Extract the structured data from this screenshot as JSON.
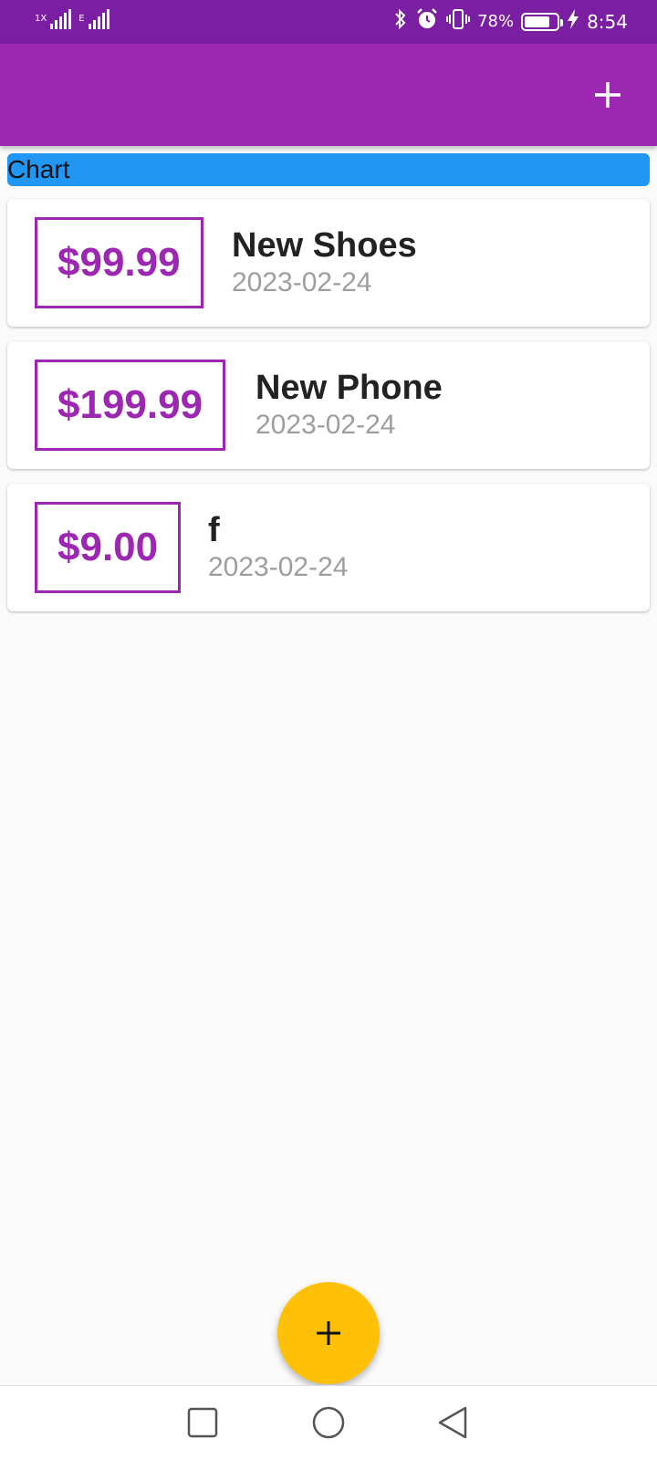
{
  "status_bar": {
    "sim1_tag": "1X",
    "sim2_tag": "E",
    "battery_percent_text": "78%",
    "battery_level": 0.78,
    "time": "8:54",
    "icons": [
      "signal-icon",
      "bluetooth-icon",
      "alarm-icon",
      "vibrate-icon",
      "battery-icon",
      "charging-icon"
    ]
  },
  "app_bar": {
    "title": "",
    "add_icon": "plus-icon"
  },
  "chart": {
    "label": "Chart"
  },
  "transactions": [
    {
      "amount": "$99.99",
      "title": "New Shoes",
      "date": "2023-02-24"
    },
    {
      "amount": "$199.99",
      "title": "New Phone",
      "date": "2023-02-24"
    },
    {
      "amount": "$9.00",
      "title": "f",
      "date": "2023-02-24"
    }
  ],
  "fab": {
    "icon": "plus-icon"
  },
  "nav_bar": {
    "icons": [
      "recents-square-icon",
      "home-circle-icon",
      "back-triangle-icon"
    ]
  },
  "colors": {
    "status_bar": "#7B1FA2",
    "primary": "#9C27B0",
    "chart_bar": "#2196F3",
    "fab": "#FFC107",
    "background": "#FAFAFA"
  }
}
